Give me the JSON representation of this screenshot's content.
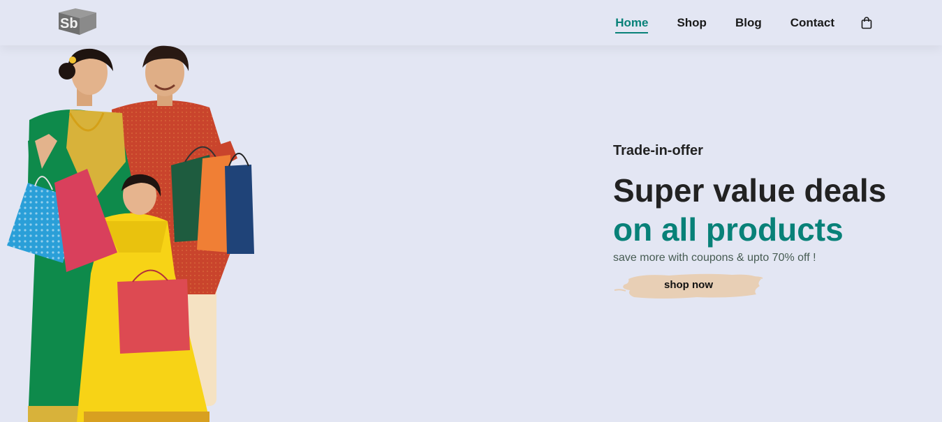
{
  "brand": {
    "logo_text": "Sb"
  },
  "nav": {
    "items": [
      {
        "label": "Home",
        "active": true
      },
      {
        "label": "Shop",
        "active": false
      },
      {
        "label": "Blog",
        "active": false
      },
      {
        "label": "Contact",
        "active": false
      }
    ],
    "cart_icon": "shopping-bag-icon"
  },
  "hero": {
    "kicker": "Trade-in-offer",
    "title_line1": "Super value deals",
    "title_line2": "on all products",
    "subtitle": "save more with coupons & upto 70% off !",
    "cta_label": "shop now"
  },
  "colors": {
    "background": "#e3e6f3",
    "accent": "#088178",
    "button_brush": "#e8cfb5",
    "text_dark": "#222222"
  }
}
